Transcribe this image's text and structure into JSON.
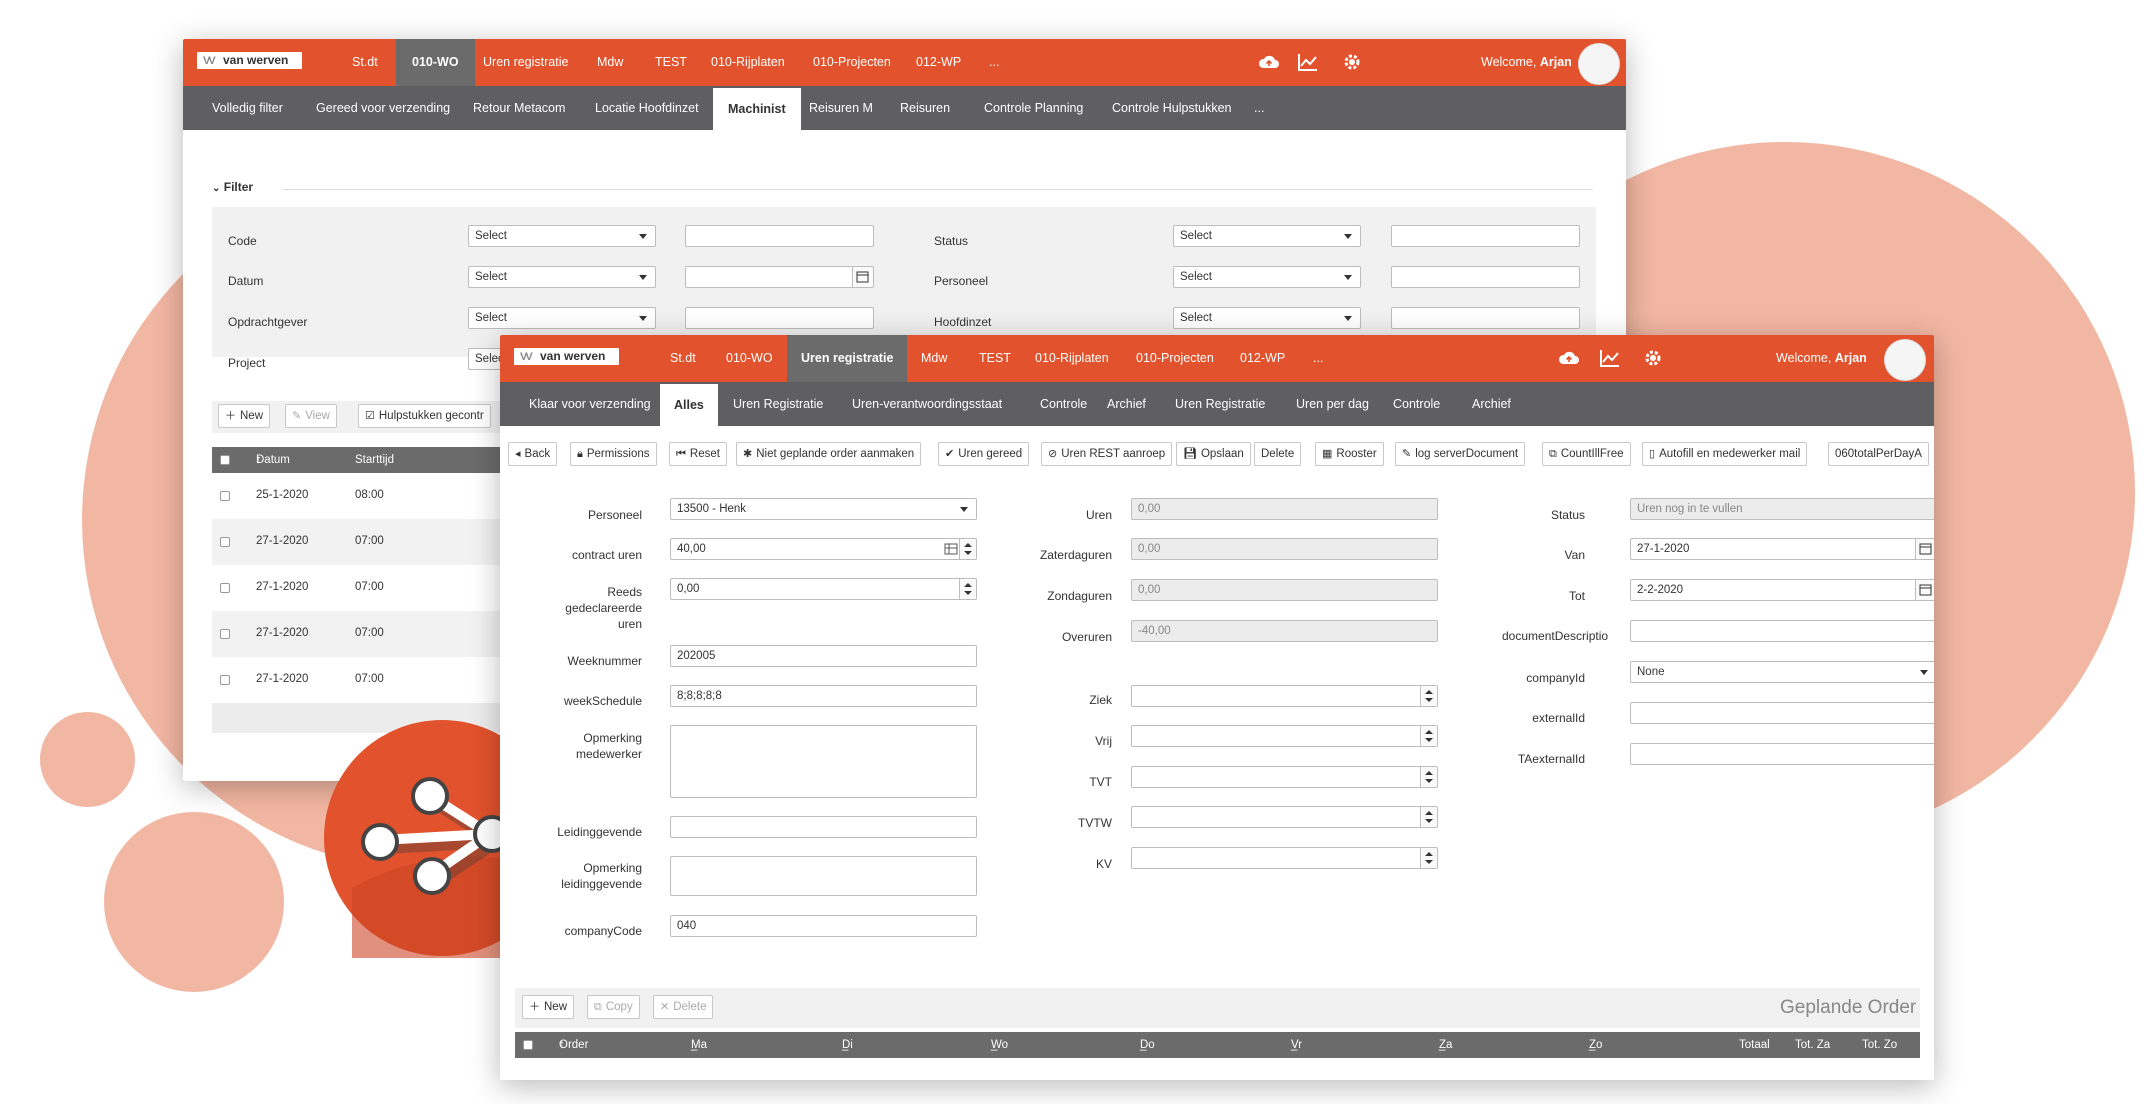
{
  "colors": {
    "accent": "#e2522c",
    "dark": "#5f5f62",
    "blob": "#f2b7a2"
  },
  "back": {
    "logo": "van werven",
    "topnav": [
      "St.dt",
      "010-WO",
      "Uren registratie",
      "Mdw",
      "TEST",
      "010-Rijplaten",
      "010-Projecten",
      "012-WP",
      "..."
    ],
    "welcome_prefix": "Welcome,",
    "user": "Arjan",
    "subnav": [
      "Volledig filter",
      "Gereed voor verzending",
      "Retour Metacom",
      "Locatie Hoofdinzet",
      "Machinist",
      "Reisuren M",
      "Reisuren",
      "Controle Planning",
      "Controle Hulpstukken",
      "..."
    ],
    "filter_title": "Filter",
    "filter_labels": {
      "code": "Code",
      "datum": "Datum",
      "opdrachtgever": "Opdrachtgever",
      "project": "Project",
      "status": "Status",
      "personeel": "Personeel",
      "hoofdinzet": "Hoofdinzet"
    },
    "select_placeholder": "Select",
    "toolbar": {
      "new": "New",
      "view": "View",
      "hulpstukken": "Hulpstukken gecontr"
    },
    "table_headers": {
      "datum": "Datum",
      "starttijd": "Starttijd"
    },
    "rows": [
      {
        "datum": "25-1-2020",
        "tijd": "08:00"
      },
      {
        "datum": "27-1-2020",
        "tijd": "07:00"
      },
      {
        "datum": "27-1-2020",
        "tijd": "07:00"
      },
      {
        "datum": "27-1-2020",
        "tijd": "07:00"
      },
      {
        "datum": "27-1-2020",
        "tijd": "07:00"
      }
    ]
  },
  "front": {
    "logo": "van werven",
    "topnav": [
      "St.dt",
      "010-WO",
      "Uren registratie",
      "Mdw",
      "TEST",
      "010-Rijplaten",
      "010-Projecten",
      "012-WP",
      "..."
    ],
    "welcome_prefix": "Welcome,",
    "user": "Arjan",
    "subnav": [
      "Klaar voor verzending",
      "Alles",
      "Uren Registratie",
      "Uren-verantwoordingsstaat",
      "Controle",
      "Archief",
      "Uren Registratie",
      "Uren per dag",
      "Controle",
      "Archief"
    ],
    "buttons": [
      "Back",
      "Permissions",
      "Reset",
      "Niet geplande order aanmaken",
      "Uren gereed",
      "Uren REST aanroep",
      "Opslaan",
      "Delete",
      "Rooster",
      "log serverDocument",
      "CountIllFree",
      "Autofill en medewerker mail",
      "060totalPerDayA"
    ],
    "col1": {
      "personeel_label": "Personeel",
      "personeel_value": "13500 - Henk",
      "contract_label": "contract uren",
      "contract_value": "40,00",
      "reeds_label1": "Reeds",
      "reeds_label2": "gedeclareerde",
      "reeds_label3": "uren",
      "reeds_value": "0,00",
      "weeknummer_label": "Weeknummer",
      "weeknummer_value": "202005",
      "weekschedule_label": "weekSchedule",
      "weekschedule_value": "8;8;8;8;8",
      "opm_med_label1": "Opmerking",
      "opm_med_label2": "medewerker",
      "leiding_label": "Leidinggevende",
      "opm_leid_label1": "Opmerking",
      "opm_leid_label2": "leidinggevende",
      "company_label": "companyCode",
      "company_value": "040"
    },
    "col2": {
      "uren_label": "Uren",
      "uren_value": "0,00",
      "zater_label": "Zaterdaguren",
      "zater_value": "0,00",
      "zon_label": "Zondaguren",
      "zon_value": "0,00",
      "over_label": "Overuren",
      "over_value": "-40,00",
      "ziek_label": "Ziek",
      "vrij_label": "Vrij",
      "tvt_label": "TVT",
      "tvtw_label": "TVTW",
      "kv_label": "KV"
    },
    "col3": {
      "status_label": "Status",
      "status_value": "Uren nog in te vullen",
      "van_label": "Van",
      "van_value": "27-1-2020",
      "tot_label": "Tot",
      "tot_value": "2-2-2020",
      "doc_label": "documentDescriptio",
      "companyid_label": "companyId",
      "companyid_value": "None",
      "externalid_label": "externalId",
      "taexternal_label": "TAexternalId"
    },
    "grid_toolbar": {
      "new": "New",
      "copy": "Copy",
      "delete": "Delete",
      "title": "Geplande Order"
    },
    "grid_headers": [
      "Order",
      "Ma",
      "Di",
      "Wo",
      "Do",
      "Vr",
      "Za",
      "Zo",
      "Totaal",
      "Tot. Za",
      "Tot. Zo"
    ]
  }
}
